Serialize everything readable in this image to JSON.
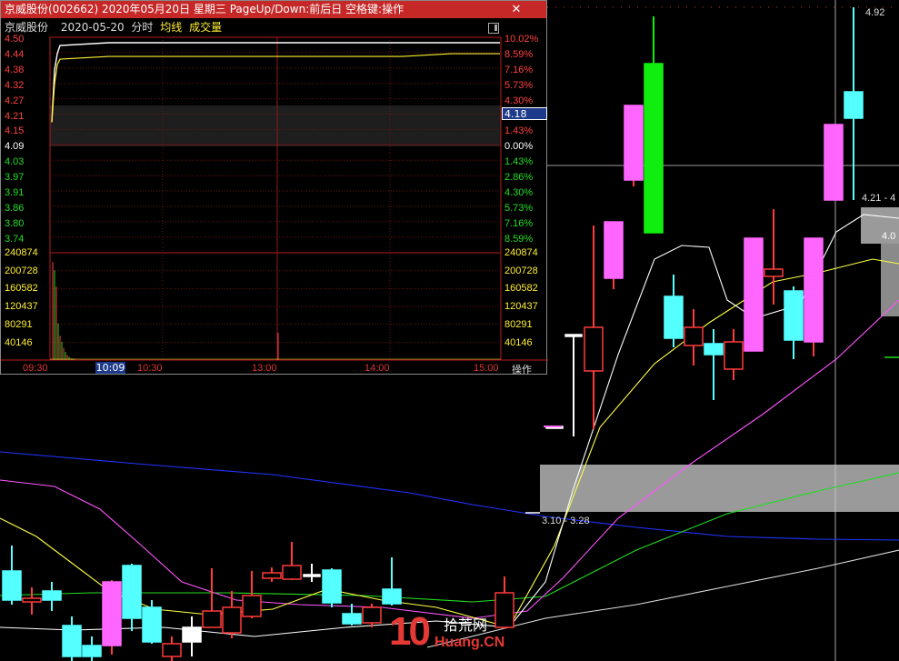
{
  "window": {
    "title": "京威股份(002662)  2020年05月20日  星期三  PageUp/Down:前后日  空格键:操作",
    "close_glyph": "✕"
  },
  "info": {
    "name": "京威股份",
    "date": "2020-05-20",
    "mode": "分时",
    "avg_label": "均线",
    "vol_label": "成交量"
  },
  "price_labels": [
    {
      "price": "4.50",
      "pct": "10.02%",
      "color": "#ff4040"
    },
    {
      "price": "4.44",
      "pct": "8.59%",
      "color": "#ff4040"
    },
    {
      "price": "4.38",
      "pct": "7.16%",
      "color": "#ff4040"
    },
    {
      "price": "4.32",
      "pct": "5.73%",
      "color": "#ff4040"
    },
    {
      "price": "4.27",
      "pct": "4.30%",
      "color": "#ff4040"
    },
    {
      "price": "4.21",
      "pct": "",
      "color": "#ff4040"
    },
    {
      "price": "4.15",
      "pct": "1.43%",
      "color": "#ff4040"
    },
    {
      "price": "4.09",
      "pct": "0.00%",
      "color": "#ffffff"
    },
    {
      "price": "4.03",
      "pct": "1.43%",
      "color": "#22dd22"
    },
    {
      "price": "3.97",
      "pct": "2.86%",
      "color": "#22dd22"
    },
    {
      "price": "3.91",
      "pct": "4.30%",
      "color": "#22dd22"
    },
    {
      "price": "3.86",
      "pct": "5.73%",
      "color": "#22dd22"
    },
    {
      "price": "3.80",
      "pct": "7.16%",
      "color": "#22dd22"
    },
    {
      "price": "3.74",
      "pct": "8.59%",
      "color": "#22dd22"
    }
  ],
  "crosshair_price": "4.18",
  "volume_labels": [
    "240874",
    "200728",
    "160582",
    "120437",
    "80291",
    "40146"
  ],
  "time_labels": [
    "09:30",
    "10:30",
    "13:00",
    "14:00",
    "15:00"
  ],
  "crosshair_time": "10:09",
  "operate_button": "操作",
  "kline": {
    "high_label": "4.92",
    "zone_upper_label": "4.21 - 4",
    "zone_upper_small": "4.0",
    "zone_lower_label": "3.10 - 3.28"
  },
  "watermark": {
    "number": "10",
    "cn": "拾荒网",
    "en": "Huang.CN"
  },
  "colors": {
    "up": "#ff3b3b",
    "down": "#54ffff",
    "green_candle": "#10ee10",
    "magenta_candle": "#ff66ff",
    "title_bar": "#c62828"
  },
  "intraday": {
    "price": [
      4.21,
      4.4,
      4.46,
      4.49,
      4.5,
      4.5,
      4.5,
      4.5,
      4.5,
      4.5,
      4.5,
      4.5,
      4.5
    ],
    "avg": [
      4.21,
      4.35,
      4.42,
      4.44,
      4.45,
      4.45,
      4.45,
      4.45,
      4.45,
      4.45,
      4.45,
      4.46,
      4.46
    ],
    "volume": [
      240874,
      220000,
      180000,
      90000,
      60000,
      45000,
      30000,
      20000,
      12000,
      8000,
      5000,
      4000,
      3000
    ]
  }
}
